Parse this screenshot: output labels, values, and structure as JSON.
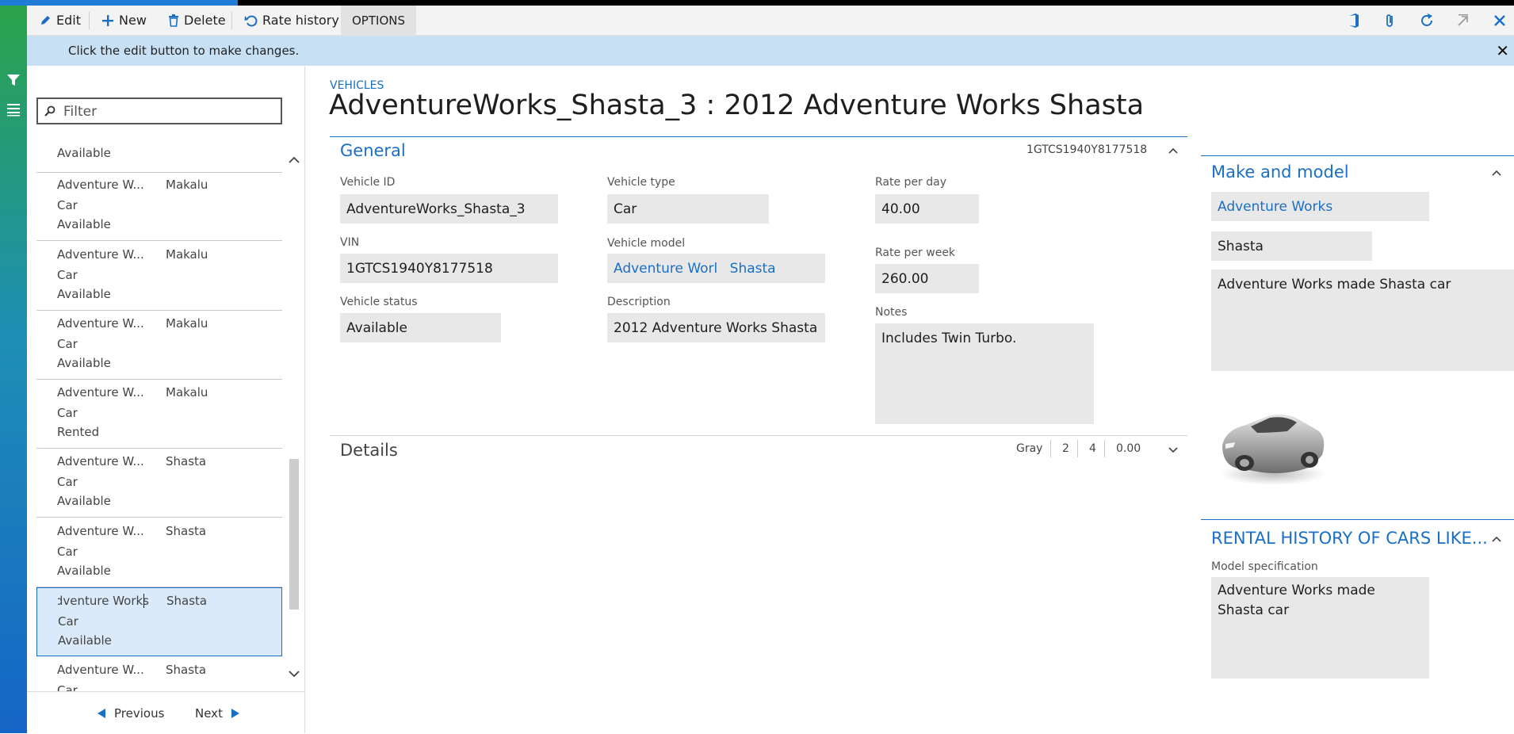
{
  "action_pane": {
    "edit": "Edit",
    "new": "New",
    "delete": "Delete",
    "rate_history": "Rate history",
    "options": "OPTIONS"
  },
  "message_bar": {
    "text": "Click the edit button to make changes."
  },
  "list": {
    "filter_placeholder": "Filter",
    "top_partial": "Available",
    "rows": [
      {
        "name": "Adventure W...",
        "model": "Makalu",
        "type": "Car",
        "status": "Available"
      },
      {
        "name": "Adventure W...",
        "model": "Makalu",
        "type": "Car",
        "status": "Available"
      },
      {
        "name": "Adventure W...",
        "model": "Makalu",
        "type": "Car",
        "status": "Available"
      },
      {
        "name": "Adventure W...",
        "model": "Makalu",
        "type": "Car",
        "status": "Rented"
      },
      {
        "name": "Adventure W...",
        "model": "Shasta",
        "type": "Car",
        "status": "Available"
      },
      {
        "name": "Adventure W...",
        "model": "Shasta",
        "type": "Car",
        "status": "Available"
      },
      {
        "name": "Adventure Works",
        "model": "Shasta",
        "type": "Car",
        "status": "Available"
      },
      {
        "name": "Adventure W...",
        "model": "Shasta",
        "type": "Car",
        "status": ""
      }
    ],
    "previous": "Previous",
    "next": "Next"
  },
  "form": {
    "caption": "VEHICLES",
    "title": "AdventureWorks_Shasta_3 : 2012 Adventure Works Shasta"
  },
  "general": {
    "header": "General",
    "summary": "1GTCS1940Y8177518",
    "vehicle_id_label": "Vehicle ID",
    "vehicle_id": "AdventureWorks_Shasta_3",
    "vin_label": "VIN",
    "vin": "1GTCS1940Y8177518",
    "vehicle_status_label": "Vehicle status",
    "vehicle_status": "Available",
    "vehicle_type_label": "Vehicle type",
    "vehicle_type": "Car",
    "vehicle_model_label": "Vehicle model",
    "vehicle_model_make": "Adventure Worl",
    "vehicle_model_model": "Shasta",
    "description_label": "Description",
    "description": "2012 Adventure Works Shasta",
    "rate_day_label": "Rate per day",
    "rate_day": "40.00",
    "rate_week_label": "Rate per week",
    "rate_week": "260.00",
    "notes_label": "Notes",
    "notes": "Includes Twin Turbo."
  },
  "details": {
    "header": "Details",
    "summary": [
      "Gray",
      "2",
      "4",
      "0.00"
    ]
  },
  "make_model": {
    "header": "Make and model",
    "make": "Adventure Works",
    "model": "Shasta",
    "description": "Adventure Works made Shasta car"
  },
  "rental_history": {
    "header": "RENTAL HISTORY OF CARS LIKE...",
    "spec_label": "Model specification",
    "spec": "Adventure Works made Shasta car"
  },
  "colors": {
    "accent": "#1a6fc4",
    "message_bar": "#c8e0f4",
    "field_bg": "#e8e8e8"
  }
}
